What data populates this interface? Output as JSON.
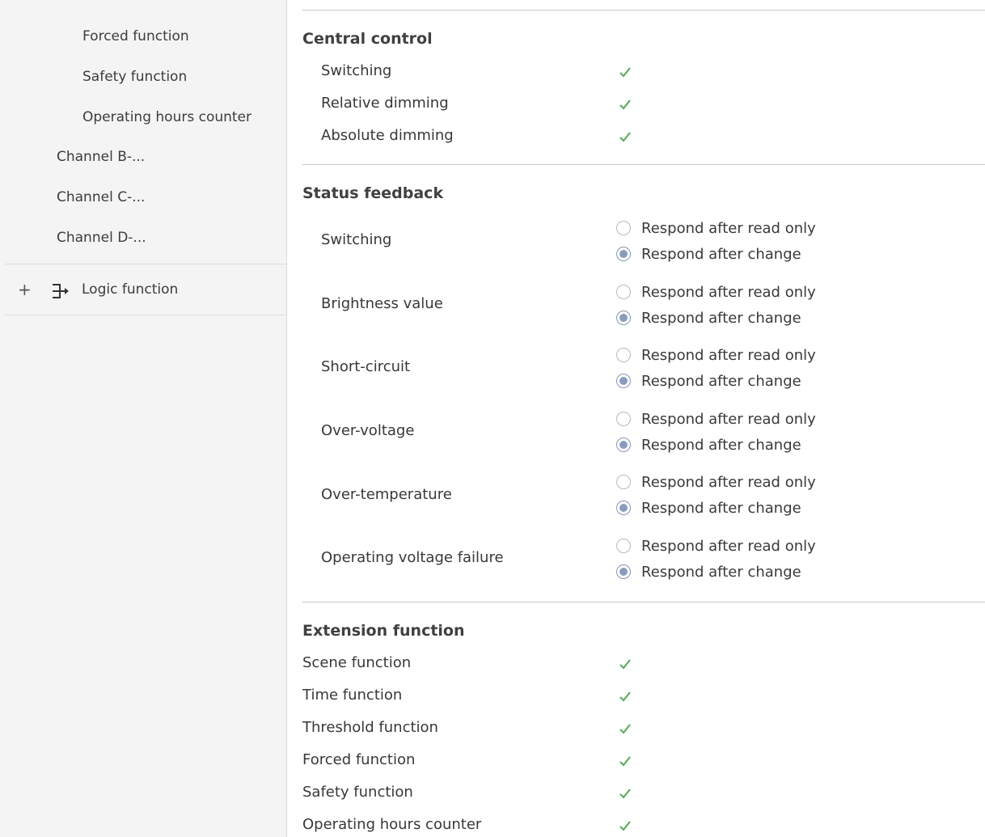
{
  "sidebar": {
    "items": [
      {
        "label": "Forced function"
      },
      {
        "label": "Safety function"
      },
      {
        "label": "Operating hours counter"
      },
      {
        "label": "Channel B-..."
      },
      {
        "label": "Channel C-..."
      },
      {
        "label": "Channel D-..."
      }
    ],
    "logic": {
      "expand": "+",
      "icon": "logic-function-icon",
      "label": "Logic function"
    }
  },
  "central_control": {
    "title": "Central control",
    "items": [
      {
        "label": "Switching",
        "checked": true
      },
      {
        "label": "Relative dimming",
        "checked": true
      },
      {
        "label": "Absolute dimming",
        "checked": true
      }
    ]
  },
  "status_feedback": {
    "title": "Status feedback",
    "option_read": "Respond after read only",
    "option_change": "Respond after change",
    "items": [
      {
        "label": "Switching",
        "selected": "Respond after change"
      },
      {
        "label": "Brightness value",
        "selected": "Respond after change"
      },
      {
        "label": "Short-circuit",
        "selected": "Respond after change"
      },
      {
        "label": "Over-voltage",
        "selected": "Respond after change"
      },
      {
        "label": "Over-temperature",
        "selected": "Respond after change"
      },
      {
        "label": "Operating voltage failure",
        "selected": "Respond after change"
      }
    ]
  },
  "extension_function": {
    "title": "Extension function",
    "items": [
      {
        "label": "Scene function",
        "checked": true
      },
      {
        "label": "Time function",
        "checked": true
      },
      {
        "label": "Threshold function",
        "checked": true
      },
      {
        "label": "Forced function",
        "checked": true
      },
      {
        "label": "Safety function",
        "checked": true
      },
      {
        "label": "Operating hours counter",
        "checked": true
      }
    ]
  },
  "colors": {
    "check": "#5cae5f",
    "radio_fill": "#8c9bbd",
    "sidebar_bg": "#f4f4f4"
  }
}
